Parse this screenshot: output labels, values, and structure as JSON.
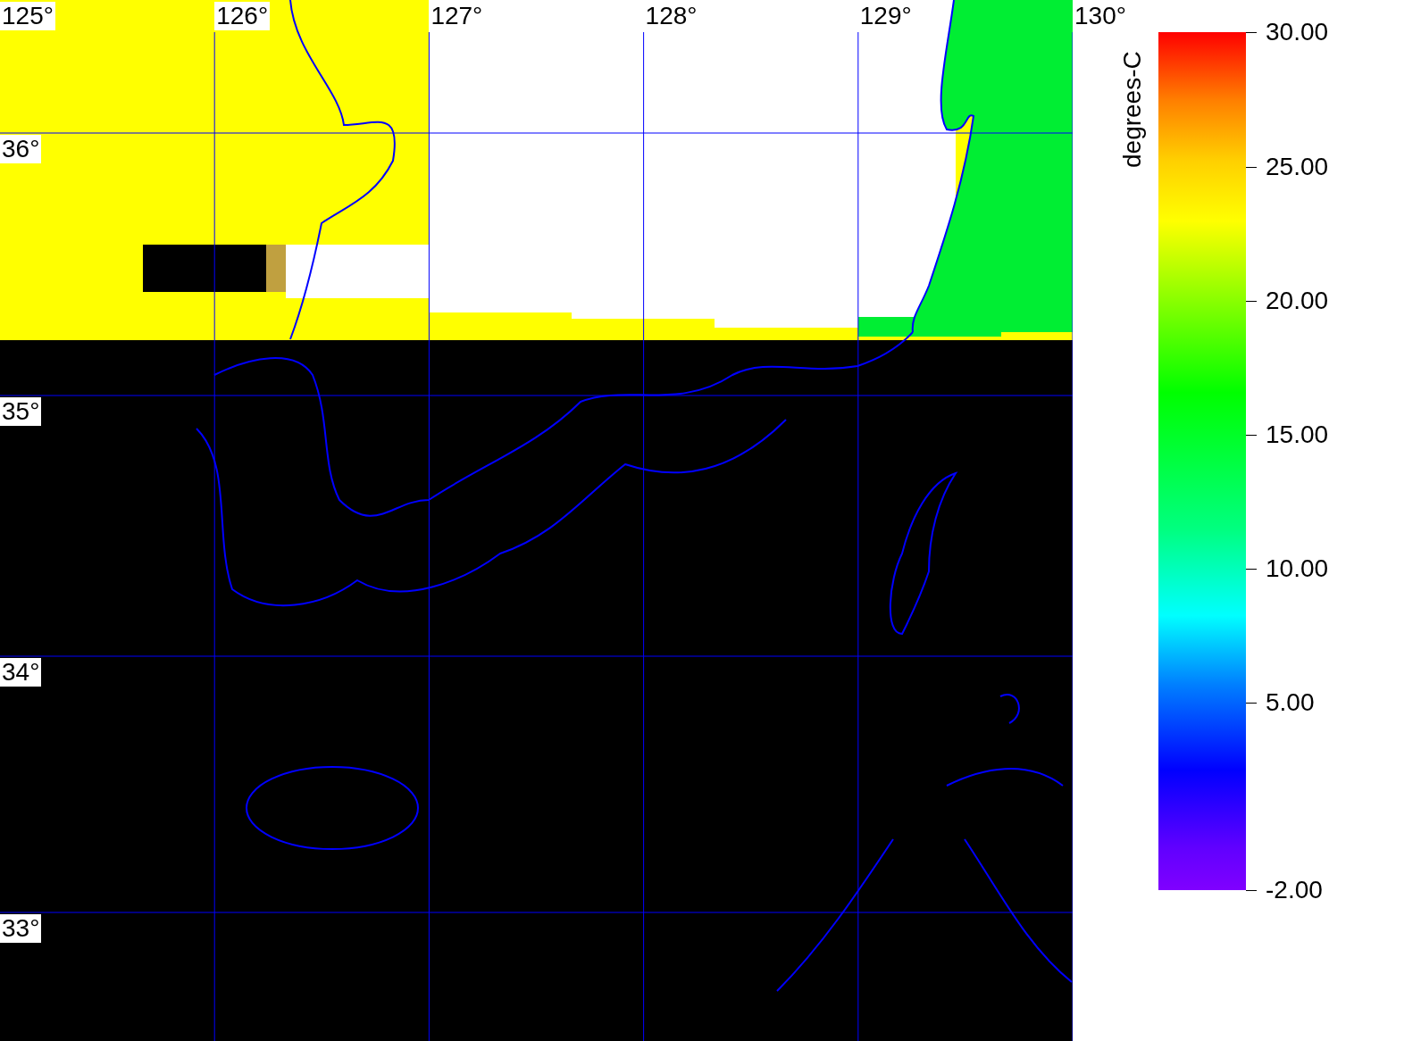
{
  "map": {
    "longitude_labels": [
      "125°",
      "126°",
      "127°",
      "128°",
      "129°",
      "130°"
    ],
    "latitude_labels": [
      "36°",
      "35°",
      "34°",
      "33°"
    ]
  },
  "legend": {
    "unit": "degrees-C",
    "ticks": [
      "30.00",
      "25.00",
      "20.00",
      "15.00",
      "10.00",
      "5.00",
      "-2.00"
    ]
  }
}
